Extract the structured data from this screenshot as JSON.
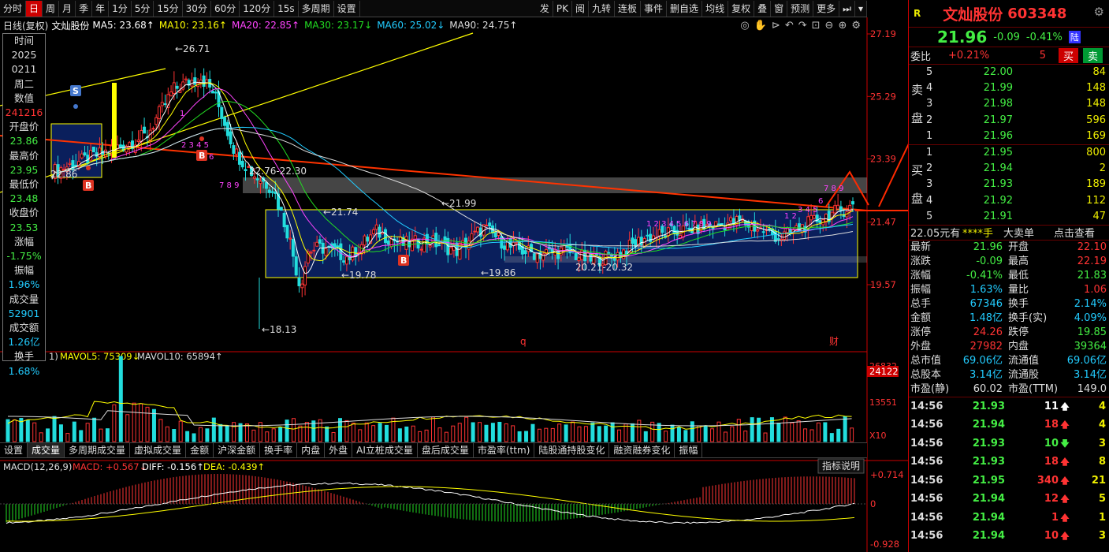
{
  "toolbar": {
    "left": [
      "分时",
      "日",
      "周",
      "月",
      "季",
      "年",
      "1分",
      "5分",
      "15分",
      "30分",
      "60分",
      "120分",
      "15s",
      "多周期",
      "设置"
    ],
    "active": "日",
    "right": [
      "发",
      "PK",
      "阅",
      "九转",
      "连板",
      "事件",
      "删自选",
      "均线",
      "复权",
      "叠",
      "窗",
      "预测",
      "更多"
    ]
  },
  "ma_bar": {
    "prefix": "日线(复权)",
    "name": "文灿股份",
    "items": [
      {
        "label": "MA5: 23.68",
        "arrow": "↑",
        "color": "#ffffff"
      },
      {
        "label": "MA10: 23.16",
        "arrow": "↑",
        "color": "#ffff00"
      },
      {
        "label": "MA20: 22.85",
        "arrow": "↑",
        "color": "#ff44ff"
      },
      {
        "label": "MA30: 23.17",
        "arrow": "↓",
        "color": "#22dd22"
      },
      {
        "label": "MA60: 25.02",
        "arrow": "↓",
        "color": "#22ccff"
      },
      {
        "label": "MA90: 24.75",
        "arrow": "↑",
        "color": "#dddddd"
      }
    ]
  },
  "infobox": [
    {
      "label": "时间",
      "value": "",
      "vcolor": "#ddd"
    },
    {
      "label": "2025",
      "value": "",
      "vcolor": "#ddd"
    },
    {
      "label": "0211",
      "value": "",
      "vcolor": "#ddd"
    },
    {
      "label": "周二",
      "value": "",
      "vcolor": "#ddd"
    },
    {
      "label": "数值",
      "value": "241216",
      "vcolor": "#ff3333"
    },
    {
      "label": "开盘价",
      "value": "23.86",
      "vcolor": "#44ee44"
    },
    {
      "label": "最高价",
      "value": "23.95",
      "vcolor": "#44ee44"
    },
    {
      "label": "最低价",
      "value": "23.48",
      "vcolor": "#44ee44"
    },
    {
      "label": "收盘价",
      "value": "23.53",
      "vcolor": "#44ee44"
    },
    {
      "label": "涨幅",
      "value": "-1.75%",
      "vcolor": "#44ee44"
    },
    {
      "label": "振幅",
      "value": "1.96%",
      "vcolor": "#22ccff"
    },
    {
      "label": "成交量",
      "value": "52901",
      "vcolor": "#22ccff"
    },
    {
      "label": "成交额",
      "value": "1.26亿",
      "vcolor": "#22ccff"
    },
    {
      "label": "换手",
      "value": "1.68%",
      "vcolor": "#22ccff"
    }
  ],
  "price_axis": [
    "27.19",
    "25.29",
    "23.39",
    "21.47",
    "19.57"
  ],
  "annotations": {
    "hi": "26.71",
    "lo": "18.13",
    "l1": "22.86",
    "l2": "22.76-22.30",
    "l3": "21.74",
    "l4": "21.99",
    "l5": "19.78",
    "l6": "19.86",
    "l7": "20.21-20.32",
    "q": "q",
    "cai": "财",
    "s": "S",
    "b": "B",
    "seq1": "1",
    "seq2": "2 3 4 5",
    "seq3": "6",
    "seq4": "7 8 9",
    "seq5": "1 2 3 4 5 6 7 8 9",
    "seq6": "3 4 5",
    "seq7": "6",
    "seq8": "7 8 9",
    "seq9": "1 2"
  },
  "vol_bar": {
    "prefix": "1)",
    "mavol5": "MAVOL5: 75309",
    "mavol5_arrow": "↓",
    "mavol10": "MAVOL10: 65894",
    "mavol10_arrow": "↑"
  },
  "vol_axis": [
    "26832",
    "24122",
    "13551",
    "X10"
  ],
  "tabs": [
    "设置",
    "成交量",
    "多周期成交量",
    "虚拟成交量",
    "金额",
    "沪深金额",
    "换手率",
    "内盘",
    "外盘",
    "AI立桩成交量",
    "盘后成交量",
    "市盈率(ttm)",
    "陆股通持股变化",
    "融资融券变化",
    "振幅"
  ],
  "tab_active": "成交量",
  "macd_bar": {
    "prefix": "MACD(12,26,9)",
    "macd": "MACD: +0.567",
    "macd_arrow": "↓",
    "diff": "DIFF: -0.156",
    "diff_arrow": "↑",
    "dea": "DEA: -0.439",
    "dea_arrow": "↑",
    "help": "指标说明"
  },
  "macd_axis": [
    "+0.714",
    "0",
    "-0.928"
  ],
  "stock": {
    "name": "文灿股份",
    "code": "603348",
    "price": "21.96",
    "change": "-0.09",
    "pct": "-0.41%",
    "tag": "陆",
    "r": "R"
  },
  "weibi": {
    "label": "委比",
    "value": "+0.21%",
    "diff": "5",
    "buy": "买",
    "sell": "卖"
  },
  "sell_orders": [
    {
      "lvl": "5",
      "price": "22.00",
      "vol": "84"
    },
    {
      "lvl": "4",
      "price": "21.99",
      "vol": "148"
    },
    {
      "lvl": "3",
      "price": "21.98",
      "vol": "148"
    },
    {
      "lvl": "2",
      "price": "21.97",
      "vol": "596"
    },
    {
      "lvl": "1",
      "price": "21.96",
      "vol": "169"
    }
  ],
  "buy_orders": [
    {
      "lvl": "1",
      "price": "21.95",
      "vol": "800"
    },
    {
      "lvl": "2",
      "price": "21.94",
      "vol": "2"
    },
    {
      "lvl": "3",
      "price": "21.93",
      "vol": "189"
    },
    {
      "lvl": "4",
      "price": "21.92",
      "vol": "112"
    },
    {
      "lvl": "5",
      "price": "21.91",
      "vol": "47"
    }
  ],
  "sell_side": [
    "卖",
    "盘"
  ],
  "buy_side": [
    "买",
    "盘"
  ],
  "big": {
    "amount": "22.05元有",
    "stars": "****手",
    "label": "大卖单",
    "link": "点击查看"
  },
  "stats": [
    {
      "l": "最新",
      "v": "21.96",
      "vc": "#44ee44",
      "l2": "开盘",
      "v2": "22.10",
      "vc2": "#ff3333"
    },
    {
      "l": "涨跌",
      "v": "-0.09",
      "vc": "#44ee44",
      "l2": "最高",
      "v2": "22.19",
      "vc2": "#ff3333"
    },
    {
      "l": "涨幅",
      "v": "-0.41%",
      "vc": "#44ee44",
      "l2": "最低",
      "v2": "21.83",
      "vc2": "#44ee44"
    },
    {
      "l": "振幅",
      "v": "1.63%",
      "vc": "#22ccff",
      "l2": "量比",
      "v2": "1.06",
      "vc2": "#ff3333"
    },
    {
      "l": "总手",
      "v": "67346",
      "vc": "#22ccff",
      "l2": "换手",
      "v2": "2.14%",
      "vc2": "#22ccff"
    },
    {
      "l": "金额",
      "v": "1.48亿",
      "vc": "#22ccff",
      "l2": "换手(实)",
      "v2": "4.09%",
      "vc2": "#22ccff"
    },
    {
      "l": "涨停",
      "v": "24.26",
      "vc": "#ff3333",
      "l2": "跌停",
      "v2": "19.85",
      "vc2": "#44ee44"
    },
    {
      "l": "外盘",
      "v": "27982",
      "vc": "#ff3333",
      "l2": "内盘",
      "v2": "39364",
      "vc2": "#44ee44"
    },
    {
      "l": "总市值",
      "v": "69.06亿",
      "vc": "#22ccff",
      "l2": "流通值",
      "v2": "69.06亿",
      "vc2": "#22ccff"
    },
    {
      "l": "总股本",
      "v": "3.14亿",
      "vc": "#22ccff",
      "l2": "流通股",
      "v2": "3.14亿",
      "vc2": "#22ccff"
    },
    {
      "l": "市盈(静)",
      "v": "60.02",
      "vc": "#ddd",
      "l2": "市盈(TTM)",
      "v2": "149.0",
      "vc2": "#ddd"
    }
  ],
  "ticks": [
    {
      "t": "14:56",
      "p": "21.93",
      "v": "11",
      "d": "up",
      "vc": "#ffffff",
      "n": "4"
    },
    {
      "t": "14:56",
      "p": "21.94",
      "v": "18",
      "d": "up",
      "vc": "#ff3333",
      "n": "4"
    },
    {
      "t": "14:56",
      "p": "21.93",
      "v": "10",
      "d": "down",
      "vc": "#44ee44",
      "n": "3"
    },
    {
      "t": "14:56",
      "p": "21.93",
      "v": "18",
      "d": "up",
      "vc": "#ff3333",
      "n": "8"
    },
    {
      "t": "14:56",
      "p": "21.95",
      "v": "340",
      "d": "up",
      "vc": "#ff3333",
      "n": "21"
    },
    {
      "t": "14:56",
      "p": "21.94",
      "v": "12",
      "d": "up",
      "vc": "#ff3333",
      "n": "5"
    },
    {
      "t": "14:56",
      "p": "21.94",
      "v": "1",
      "d": "up",
      "vc": "#ff3333",
      "n": "1"
    },
    {
      "t": "14:56",
      "p": "21.94",
      "v": "10",
      "d": "up",
      "vc": "#ff3333",
      "n": "3"
    }
  ]
}
